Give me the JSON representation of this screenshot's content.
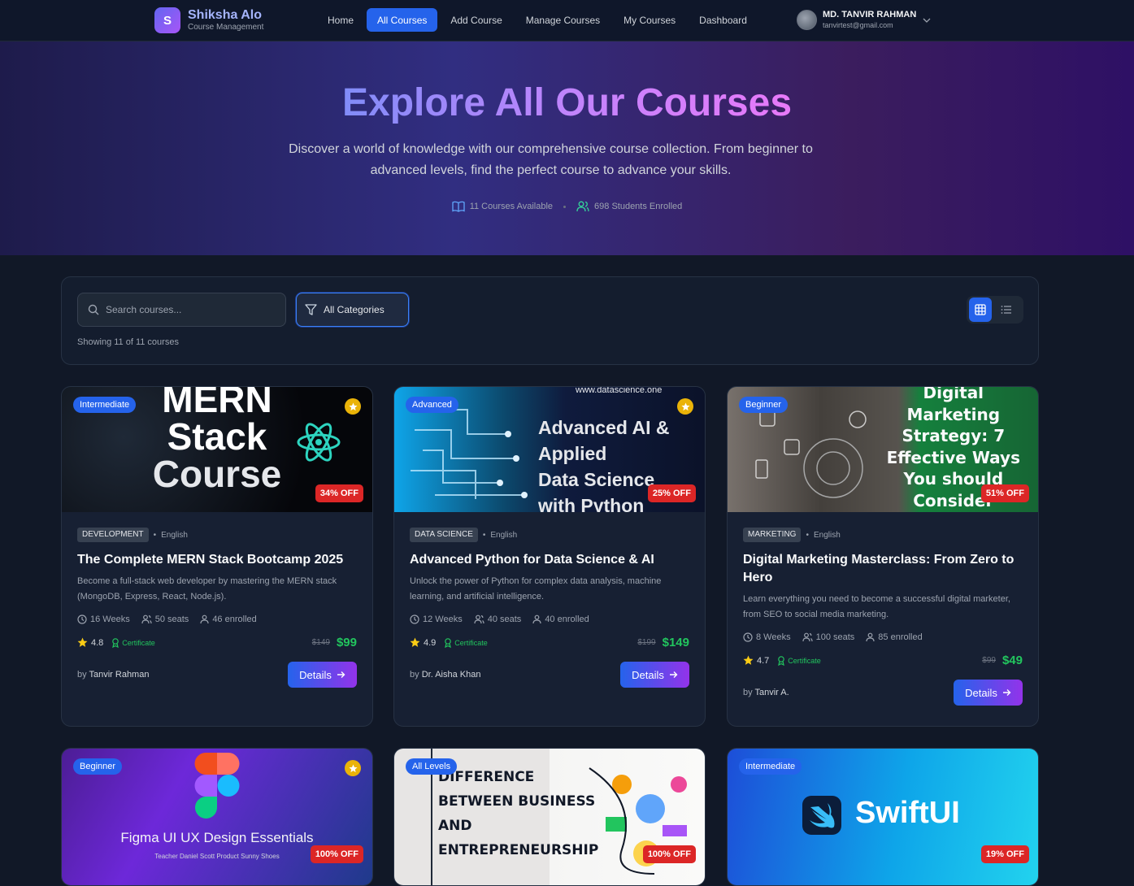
{
  "nav": {
    "brand_initial": "S",
    "brand_name": "Shiksha Alo",
    "brand_sub": "Course Management",
    "links": [
      "Home",
      "All Courses",
      "Add Course",
      "Manage Courses",
      "My Courses",
      "Dashboard"
    ],
    "active_link": "All Courses",
    "user_name": "MD. TANVIR RAHMAN",
    "user_email": "tanvirtest@gmail.com"
  },
  "hero": {
    "title": "Explore All Our Courses",
    "description": "Discover a world of knowledge with our comprehensive course collection. From beginner to advanced levels, find the perfect course to advance your skills.",
    "courses_available": "11 Courses Available",
    "students_enrolled": "698 Students Enrolled"
  },
  "filters": {
    "search_placeholder": "Search courses...",
    "category": "All Categories",
    "showing": "Showing 11 of 11 courses",
    "view_mode": "grid"
  },
  "cards": [
    {
      "level": "Intermediate",
      "featured": true,
      "discount": "34% OFF",
      "thumb_text": [
        "MERN",
        "Stack",
        "Course"
      ],
      "category": "DEVELOPMENT",
      "language": "English",
      "title": "The Complete MERN Stack Bootcamp 2025",
      "description": "Become a full-stack web developer by mastering the MERN stack (MongoDB, Express, React, Node.js).",
      "duration": "16 Weeks",
      "seats": "50 seats",
      "enrolled": "46 enrolled",
      "rating": "4.8",
      "certificate": "Certificate",
      "old_price": "$149",
      "price": "$99",
      "by_label": "by",
      "instructor": "Tanvir Rahman",
      "button": "Details"
    },
    {
      "level": "Advanced",
      "featured": true,
      "discount": "25% OFF",
      "thumb_text": [
        "www.datascience.one",
        "Advanced AI &",
        "Applied",
        "Data Science",
        "with Python"
      ],
      "category": "DATA SCIENCE",
      "language": "English",
      "title": "Advanced Python for Data Science & AI",
      "description": "Unlock the power of Python for complex data analysis, machine learning, and artificial intelligence.",
      "duration": "12 Weeks",
      "seats": "40 seats",
      "enrolled": "40 enrolled",
      "rating": "4.9",
      "certificate": "Certificate",
      "old_price": "$199",
      "price": "$149",
      "by_label": "by",
      "instructor": "Dr. Aisha Khan",
      "button": "Details"
    },
    {
      "level": "Beginner",
      "featured": false,
      "discount": "51% OFF",
      "thumb_text": [
        "Digital",
        "Marketing",
        "Strategy: 7",
        "Effective Ways",
        "You should",
        "Consider"
      ],
      "category": "MARKETING",
      "language": "English",
      "title": "Digital Marketing Masterclass: From Zero to Hero",
      "description": "Learn everything you need to become a successful digital marketer, from SEO to social media marketing.",
      "duration": "8 Weeks",
      "seats": "100 seats",
      "enrolled": "85 enrolled",
      "rating": "4.7",
      "certificate": "Certificate",
      "old_price": "$99",
      "price": "$49",
      "by_label": "by",
      "instructor": "Tanvir A.",
      "button": "Details"
    },
    {
      "level": "Beginner",
      "featured": true,
      "discount": "100% OFF",
      "thumb_text": [
        "Figma UI UX Design Essentials",
        "Teacher Daniel Scott   Product Sunny Shoes"
      ]
    },
    {
      "level": "All Levels",
      "featured": false,
      "discount": "100% OFF",
      "thumb_text": [
        "DIFFERENCE",
        "BETWEEN BUSINESS",
        "AND",
        "ENTREPRENEURSHIP"
      ]
    },
    {
      "level": "Intermediate",
      "featured": false,
      "discount": "19% OFF",
      "thumb_text": [
        "SwiftUI"
      ]
    }
  ]
}
